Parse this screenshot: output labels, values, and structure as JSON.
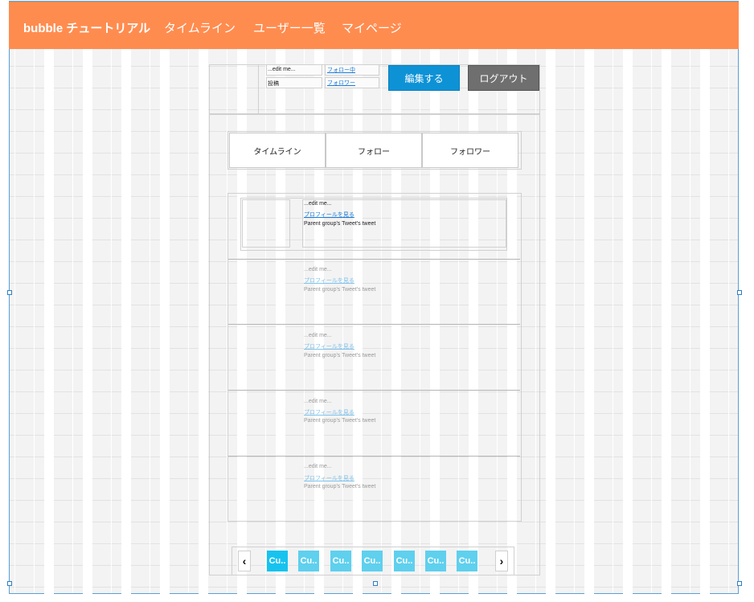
{
  "navbar": {
    "brand": "bubble チュートリアル",
    "links": [
      "タイムライン",
      "ユーザー一覧",
      "マイページ"
    ]
  },
  "profile": {
    "name_placeholder": "...edit me...",
    "posts_label": "投稿",
    "following_link": "フォロー中",
    "followers_link": "フォロワー",
    "edit_button": "編集する",
    "logout_button": "ログアウト"
  },
  "tabs": [
    "タイムライン",
    "フォロー",
    "フォロワー"
  ],
  "timeline": {
    "items": [
      {
        "name": "...edit me...",
        "profile_link": "プロフィールを見る",
        "tweet": "Parent group's Tweet's tweet"
      },
      {
        "name": "...edit me...",
        "profile_link": "プロフィールを見る",
        "tweet": "Parent group's Tweet's tweet"
      },
      {
        "name": "...edit me...",
        "profile_link": "プロフィールを見る",
        "tweet": "Parent group's Tweet's tweet"
      },
      {
        "name": "...edit me...",
        "profile_link": "プロフィールを見る",
        "tweet": "Parent group's Tweet's tweet"
      },
      {
        "name": "...edit me...",
        "profile_link": "プロフィールを見る",
        "tweet": "Parent group's Tweet's tweet"
      }
    ]
  },
  "pagination": {
    "prev": "‹",
    "next": "›",
    "pages": [
      "Cu..",
      "Cu..",
      "Cu..",
      "Cu..",
      "Cu..",
      "Cu..",
      "Cu.."
    ]
  },
  "colors": {
    "navbar": "#ff8c4f",
    "edit_button": "#0e92d6",
    "logout_button": "#6f6f6f",
    "page_active": "#16c3ef",
    "page_inactive": "#5fd0ee"
  }
}
